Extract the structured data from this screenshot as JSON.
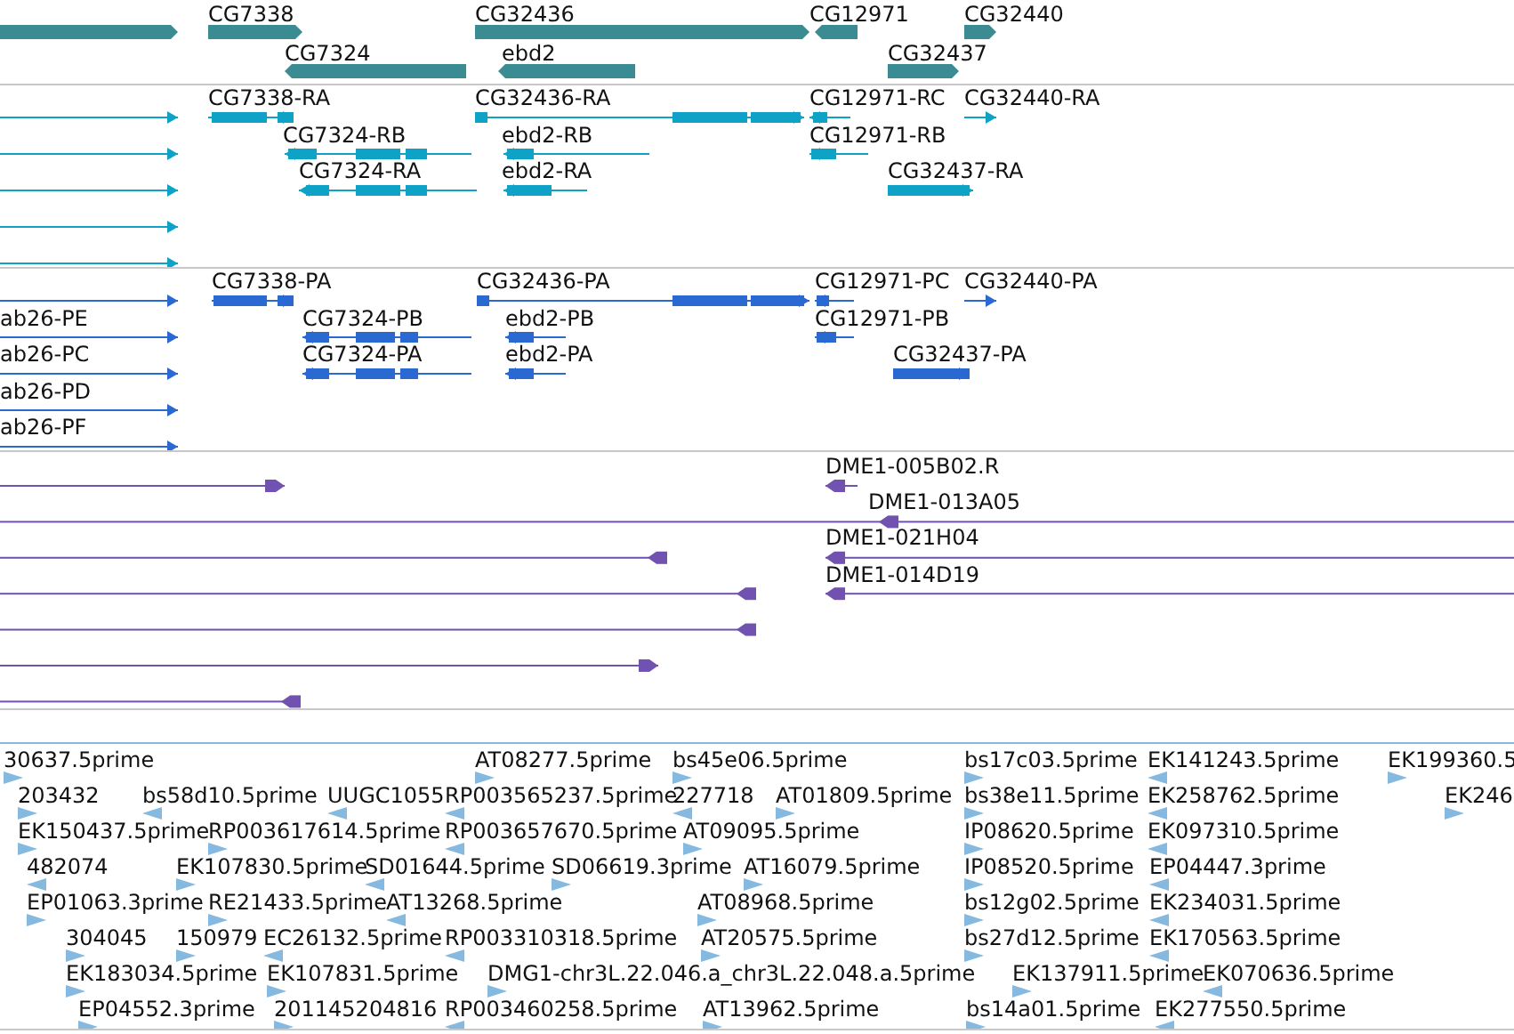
{
  "tracks": [
    {
      "kind": "gene",
      "rows": [
        {
          "features": [
            {
              "reverse": false
            },
            {
              "label": "CG7338",
              "reverse": false
            },
            {
              "label": "CG32436",
              "reverse": false
            },
            {
              "label": "CG12971",
              "reverse": true
            },
            {
              "label": "CG32440",
              "reverse": false
            }
          ]
        },
        {
          "features": [
            {
              "label": "CG7324",
              "reverse": true
            },
            {
              "label": "ebd2",
              "reverse": true
            },
            {
              "label": "CG32437",
              "reverse": false
            }
          ]
        }
      ]
    },
    {
      "kind": "transcript",
      "rows": [
        {
          "features": [
            {
              "reverse": false
            },
            {
              "label": "CG7338-RA",
              "reverse": false
            },
            {
              "label": "CG32436-RA",
              "reverse": false
            },
            {
              "label": "CG12971-RC",
              "reverse": true
            },
            {
              "label": "CG32440-RA",
              "reverse": false
            }
          ]
        },
        {
          "features": [
            {
              "reverse": false
            },
            {
              "label": "CG7324-RB",
              "reverse": true
            },
            {
              "label": "ebd2-RB",
              "reverse": true
            },
            {
              "label": "CG12971-RB",
              "reverse": true
            }
          ]
        },
        {
          "features": [
            {
              "reverse": false
            },
            {
              "label": "CG7324-RA",
              "reverse": true
            },
            {
              "label": "ebd2-RA",
              "reverse": true
            },
            {
              "label": "CG32437-RA",
              "reverse": false
            }
          ]
        },
        {
          "features": [
            {
              "reverse": false
            }
          ]
        },
        {
          "features": [
            {
              "reverse": false
            }
          ]
        }
      ]
    },
    {
      "kind": "protein",
      "rows": [
        {
          "features": [
            {
              "reverse": false
            },
            {
              "label": "CG7338-PA",
              "reverse": false
            },
            {
              "label": "CG32436-PA",
              "reverse": false
            },
            {
              "label": "CG12971-PC",
              "reverse": true
            },
            {
              "label": "CG32440-PA",
              "reverse": false
            }
          ]
        },
        {
          "features": [
            {
              "label": "ab26-PE",
              "reverse": false
            },
            {
              "label": "CG7324-PB",
              "reverse": true
            },
            {
              "label": "ebd2-PB",
              "reverse": true
            },
            {
              "label": "CG12971-PB",
              "reverse": true
            }
          ]
        },
        {
          "features": [
            {
              "label": "ab26-PC",
              "reverse": false
            },
            {
              "label": "CG7324-PA",
              "reverse": true
            },
            {
              "label": "ebd2-PA",
              "reverse": true
            },
            {
              "label": "CG32437-PA",
              "reverse": false
            }
          ]
        },
        {
          "features": [
            {
              "label": "ab26-PD",
              "reverse": false
            }
          ]
        },
        {
          "features": [
            {
              "label": "ab26-PF",
              "reverse": false
            }
          ]
        }
      ]
    },
    {
      "kind": "clone",
      "rows": [
        {
          "features": [
            {
              "reverse": false
            },
            {
              "label": "DME1-005B02.R",
              "reverse": true
            }
          ]
        },
        {
          "features": [
            {
              "label": "DME1-013A05",
              "reverse": true
            }
          ]
        },
        {
          "features": [
            {
              "reverse": true
            },
            {
              "label": "DME1-021H04",
              "reverse": true
            }
          ]
        },
        {
          "features": [
            {
              "reverse": true
            },
            {
              "label": "DME1-014D19",
              "reverse": true
            }
          ]
        },
        {
          "features": [
            {
              "reverse": true
            }
          ]
        },
        {
          "features": [
            {
              "reverse": false
            }
          ]
        },
        {
          "features": [
            {
              "reverse": true
            }
          ]
        }
      ]
    },
    {
      "kind": "est",
      "rows": [
        {
          "features": [
            {
              "label": "30637.5prime",
              "reverse": false
            },
            {
              "label": "AT08277.5prime",
              "reverse": false
            },
            {
              "label": "bs45e06.5prime",
              "reverse": false
            },
            {
              "label": "bs17c03.5prime",
              "reverse": false
            },
            {
              "label": "EK141243.5prime",
              "reverse": true
            },
            {
              "label": "EK199360.5",
              "reverse": false
            }
          ]
        },
        {
          "features": [
            {
              "label": "203432",
              "reverse": false
            },
            {
              "label": "bs58d10.5prime",
              "reverse": true
            },
            {
              "label": "UUGC1055",
              "reverse": true
            },
            {
              "label": "RP003565237.5prime",
              "reverse": true
            },
            {
              "label": "227718",
              "reverse": true
            },
            {
              "label": "AT01809.5prime",
              "reverse": false
            },
            {
              "label": "bs38e11.5prime",
              "reverse": false
            },
            {
              "label": "EK258762.5prime",
              "reverse": true
            },
            {
              "label": "EK246",
              "reverse": false
            }
          ]
        },
        {
          "features": [
            {
              "label": "EK150437.5prime",
              "reverse": false
            },
            {
              "label": "RP003617614.5prime",
              "reverse": false
            },
            {
              "label": "RP003657670.5prime",
              "reverse": true
            },
            {
              "label": "AT09095.5prime",
              "reverse": false
            },
            {
              "label": "IP08620.5prime",
              "reverse": false
            },
            {
              "label": "EK097310.5prime",
              "reverse": true
            }
          ]
        },
        {
          "features": [
            {
              "label": "482074",
              "reverse": true
            },
            {
              "label": "EK107830.5prime",
              "reverse": false
            },
            {
              "label": "SD01644.5prime",
              "reverse": true
            },
            {
              "label": "SD06619.3prime",
              "reverse": false
            },
            {
              "label": "AT16079.5prime",
              "reverse": false
            },
            {
              "label": "IP08520.5prime",
              "reverse": false
            },
            {
              "label": "EP04447.3prime",
              "reverse": true
            }
          ]
        },
        {
          "features": [
            {
              "label": "EP01063.3prime",
              "reverse": false
            },
            {
              "label": "RE21433.5prime",
              "reverse": false
            },
            {
              "label": "AT13268.5prime",
              "reverse": true
            },
            {
              "label": "AT08968.5prime",
              "reverse": false
            },
            {
              "label": "bs12g02.5prime",
              "reverse": false
            },
            {
              "label": "EK234031.5prime",
              "reverse": true
            }
          ]
        },
        {
          "features": [
            {
              "label": "304045",
              "reverse": false
            },
            {
              "label": "150979",
              "reverse": false
            },
            {
              "label": "EC26132.5prime",
              "reverse": true
            },
            {
              "label": "RP003310318.5prime",
              "reverse": true
            },
            {
              "label": "AT20575.5prime",
              "reverse": false
            },
            {
              "label": "bs27d12.5prime",
              "reverse": false
            },
            {
              "label": "EK170563.5prime",
              "reverse": true
            }
          ]
        },
        {
          "features": [
            {
              "label": "EK183034.5prime",
              "reverse": false
            },
            {
              "label": "EK107831.5prime",
              "reverse": false
            },
            {
              "label": "DMG1-chr3L.22.046.a_chr3L.22.048.a.5prime",
              "reverse": false
            },
            {
              "label": "EK137911.5prime",
              "reverse": false
            },
            {
              "label": "EK070636.5prime",
              "reverse": true
            }
          ]
        },
        {
          "features": [
            {
              "label": "EP04552.3prime",
              "reverse": false
            },
            {
              "label": "201145204816",
              "reverse": false
            },
            {
              "label": "RP003460258.5prime",
              "reverse": true
            },
            {
              "label": "AT13962.5prime",
              "reverse": false
            },
            {
              "label": "bs14a01.5prime",
              "reverse": false
            },
            {
              "label": "EK277550.5prime",
              "reverse": true
            }
          ]
        }
      ]
    }
  ]
}
